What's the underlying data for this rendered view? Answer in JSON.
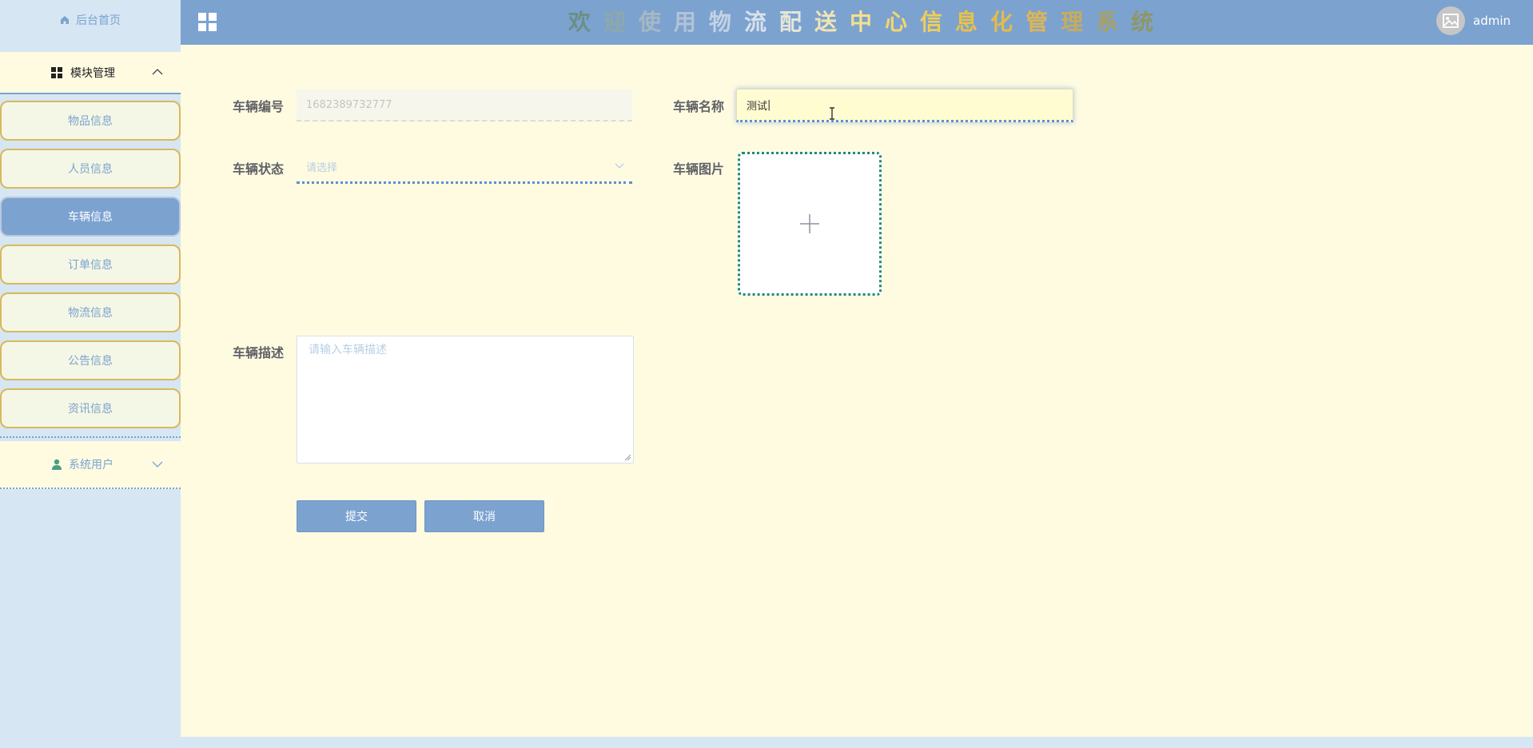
{
  "sidebar": {
    "home_label": "后台首页",
    "module_label": "模块管理",
    "items": [
      {
        "label": "物品信息",
        "active": false
      },
      {
        "label": "人员信息",
        "active": false
      },
      {
        "label": "车辆信息",
        "active": true
      },
      {
        "label": "订单信息",
        "active": false
      },
      {
        "label": "物流信息",
        "active": false
      },
      {
        "label": "公告信息",
        "active": false
      },
      {
        "label": "资讯信息",
        "active": false
      }
    ],
    "user_label": "系统用户"
  },
  "header": {
    "title_chars": [
      "欢",
      "迎",
      "使",
      "用",
      "物",
      "流",
      "配",
      "送",
      "中",
      "心",
      "信",
      "息",
      "化",
      "管",
      "理",
      "系",
      "统"
    ],
    "title_colors": [
      "#6b8f86",
      "#90a8a6",
      "#a6b8c4",
      "#b2c4d6",
      "#c2d2e2",
      "#d8e2ea",
      "#e4e6d6",
      "#f0e4b4",
      "#f5e08c",
      "#f2d76e",
      "#f0ce56",
      "#e8c248",
      "#e2bc4a",
      "#dcb656",
      "#c8ac5a",
      "#a8a062",
      "#8f9666"
    ],
    "user_name": "admin"
  },
  "form": {
    "code_label": "车辆编号",
    "code_value": "1682389732777",
    "name_label": "车辆名称",
    "name_value": "测试",
    "status_label": "车辆状态",
    "status_placeholder": "请选择",
    "image_label": "车辆图片",
    "desc_label": "车辆描述",
    "desc_placeholder": "请输入车辆描述",
    "submit_label": "提交",
    "cancel_label": "取消"
  },
  "colors": {
    "header_bg": "#7ca2d0",
    "sidebar_bg": "#d6e6f3",
    "main_bg": "#fefbe1",
    "accent": "#7ca2d0",
    "menu_border": "#d9b85c",
    "upload_border": "#1f8a7a"
  }
}
